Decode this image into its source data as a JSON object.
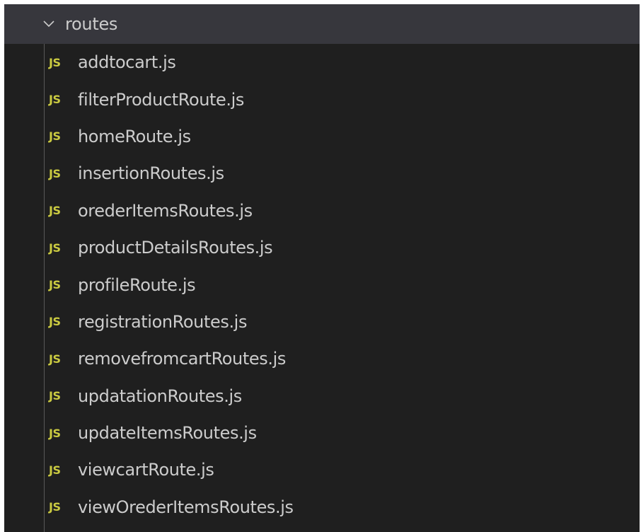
{
  "colors": {
    "panel_background": "#1f1f1f",
    "selected_row_background": "#37373d",
    "text": "#cccccc",
    "js_icon": "#cbcb41",
    "indent_guide": "#585858"
  },
  "folder": {
    "icon": "chevron-down-icon",
    "name": "routes",
    "expanded": true
  },
  "files": [
    {
      "icon_text": "JS",
      "name": "addtocart.js"
    },
    {
      "icon_text": "JS",
      "name": "filterProductRoute.js"
    },
    {
      "icon_text": "JS",
      "name": "homeRoute.js"
    },
    {
      "icon_text": "JS",
      "name": "insertionRoutes.js"
    },
    {
      "icon_text": "JS",
      "name": "orederItemsRoutes.js"
    },
    {
      "icon_text": "JS",
      "name": "productDetailsRoutes.js"
    },
    {
      "icon_text": "JS",
      "name": "profileRoute.js"
    },
    {
      "icon_text": "JS",
      "name": "registrationRoutes.js"
    },
    {
      "icon_text": "JS",
      "name": "removefromcartRoutes.js"
    },
    {
      "icon_text": "JS",
      "name": "updatationRoutes.js"
    },
    {
      "icon_text": "JS",
      "name": "updateItemsRoutes.js"
    },
    {
      "icon_text": "JS",
      "name": "viewcartRoute.js"
    },
    {
      "icon_text": "JS",
      "name": "viewOrederItemsRoutes.js"
    }
  ]
}
